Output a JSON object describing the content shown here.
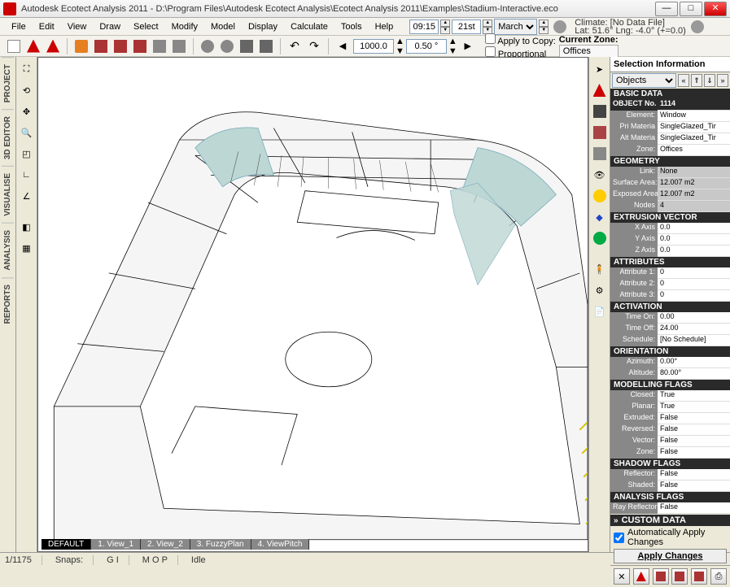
{
  "title": "Autodesk Ecotect Analysis 2011 - D:\\Program Files\\Autodesk Ecotect Analysis\\Ecotect Analysis 2011\\Examples\\Stadium-Interactive.eco",
  "menu": [
    "File",
    "Edit",
    "View",
    "Draw",
    "Select",
    "Modify",
    "Model",
    "Display",
    "Calculate",
    "Tools",
    "Help"
  ],
  "time": {
    "hour": "09:15",
    "day": "21st",
    "month": "March"
  },
  "climate": {
    "line1": "Climate: [No Data File]",
    "line2": "Lat: 51.6°   Lng: -4.0° (+=0.0)"
  },
  "toolbar_inputs": {
    "val1": "1000.0",
    "val2": "0.50 °"
  },
  "zone": {
    "apply1": "Apply to Copy:",
    "apply2": "Proportional",
    "label": "Current Zone:",
    "value": "Offices"
  },
  "left_tabs": [
    "PROJECT",
    "3D EDITOR",
    "VISUALISE",
    "ANALYSIS",
    "REPORTS"
  ],
  "view_tabs": [
    "DEFAULT",
    "1. View_1",
    "2. View_2",
    "3. FuzzyPlan",
    "4. ViewPitch"
  ],
  "panel": {
    "title": "Selection Information",
    "selector": "Objects",
    "sections": {
      "basic": {
        "hdr": "BASIC DATA",
        "rows": [
          {
            "label": "OBJECT No.",
            "value": "1114",
            "dark": true
          },
          {
            "label": "Element:",
            "value": "Window"
          },
          {
            "label": "Pri Materia",
            "value": "SingleGlazed_Tir"
          },
          {
            "label": "Alt Materia",
            "value": "SingleGlazed_Tir"
          },
          {
            "label": "Zone:",
            "value": "Offices"
          }
        ]
      },
      "geometry": {
        "hdr": "GEOMETRY",
        "rows": [
          {
            "label": "Link:",
            "value": "None",
            "gray": true
          },
          {
            "label": "Surface Area:",
            "value": "12.007 m2",
            "gray": true
          },
          {
            "label": "Exposed Area",
            "value": "12.007 m2",
            "gray": true
          },
          {
            "label": "Nodes",
            "value": "4",
            "gray": true
          }
        ]
      },
      "extrusion": {
        "hdr": "EXTRUSION VECTOR",
        "rows": [
          {
            "label": "X Axis",
            "value": "0.0"
          },
          {
            "label": "Y Axis",
            "value": "0.0"
          },
          {
            "label": "Z Axis",
            "value": "0.0"
          }
        ]
      },
      "attributes": {
        "hdr": "ATTRIBUTES",
        "rows": [
          {
            "label": "Attribute 1:",
            "value": "0"
          },
          {
            "label": "Attribute 2:",
            "value": "0"
          },
          {
            "label": "Attribute 3:",
            "value": "0"
          }
        ]
      },
      "activation": {
        "hdr": "ACTIVATION",
        "rows": [
          {
            "label": "Time On:",
            "value": "0.00"
          },
          {
            "label": "Time Off:",
            "value": "24.00"
          },
          {
            "label": "Schedule:",
            "value": "[No Schedule]"
          }
        ]
      },
      "orientation": {
        "hdr": "ORIENTATION",
        "rows": [
          {
            "label": "Azimuth:",
            "value": "0.00°"
          },
          {
            "label": "Altitude:",
            "value": "80.00°"
          }
        ]
      },
      "modelling": {
        "hdr": "MODELLING FLAGS",
        "rows": [
          {
            "label": "Closed:",
            "value": "True"
          },
          {
            "label": "Planar:",
            "value": "True"
          },
          {
            "label": "Extruded:",
            "value": "False"
          },
          {
            "label": "Reversed:",
            "value": "False"
          },
          {
            "label": "Vector:",
            "value": "False"
          },
          {
            "label": "Zone:",
            "value": "False"
          }
        ]
      },
      "shadow": {
        "hdr": "SHADOW FLAGS",
        "rows": [
          {
            "label": "Reflector:",
            "value": "False"
          },
          {
            "label": "Shaded:",
            "value": "False"
          }
        ]
      },
      "analysis": {
        "hdr": "ANALYSIS FLAGS",
        "rows": [
          {
            "label": "Ray Reflector",
            "value": "False"
          }
        ]
      },
      "custom": {
        "hdr": "CUSTOM DATA"
      }
    },
    "auto_apply": "Automatically Apply Changes",
    "apply_btn": "Apply Changes"
  },
  "status": {
    "count": "1/1175",
    "snaps": "Snaps:",
    "gi": "G I",
    "mop": "M O P",
    "idle": "Idle"
  }
}
